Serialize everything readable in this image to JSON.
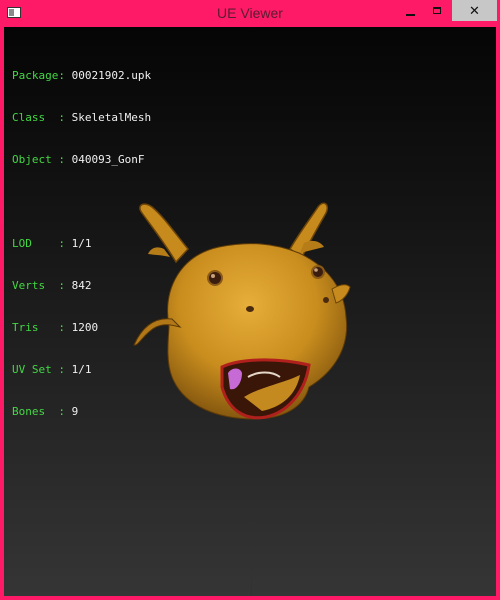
{
  "window": {
    "title": "UE Viewer",
    "close_glyph": "✕"
  },
  "info": [
    {
      "label": "Package: ",
      "value": "00021902.upk"
    },
    {
      "label": "Class  : ",
      "value": "SkeletalMesh"
    },
    {
      "label": "Object : ",
      "value": "040093_GonF"
    }
  ],
  "stats": [
    {
      "label": "LOD    : ",
      "value": "1/1"
    },
    {
      "label": "Verts  : ",
      "value": "842"
    },
    {
      "label": "Tris   : ",
      "value": "1200"
    },
    {
      "label": "UV Set : ",
      "value": "1/1"
    },
    {
      "label": "Bones  : ",
      "value": "9"
    }
  ],
  "colors": {
    "accent_border": "#ff1a68",
    "label_green": "#43d843",
    "axis_blue": "#1d1dd6",
    "mesh_skin": "#c98d1e"
  }
}
